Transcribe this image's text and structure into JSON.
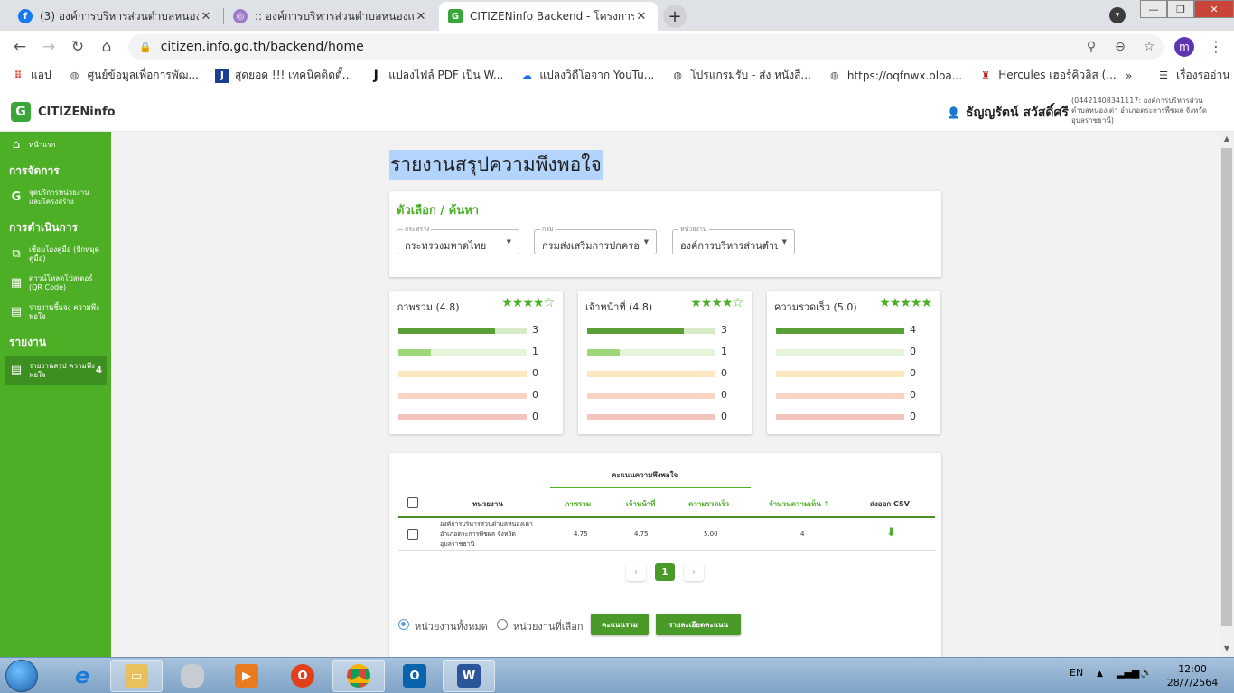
{
  "browser": {
    "tabs": [
      {
        "title": "(3) องค์การบริหารส่วนตำบลหนองเต่า |",
        "icon": "facebook-icon",
        "color": "#1877f2"
      },
      {
        "title": ":: องค์การบริหารส่วนตำบลหนองเต่า อำ",
        "icon": "site-emblem-icon",
        "color": "#9c7cc9"
      },
      {
        "title": "CITIZENinfo Backend - โครงการกา",
        "icon": "citizeninfo-icon",
        "color": "#3aa63a"
      }
    ],
    "tab_close": "✕",
    "new_tab": "+",
    "url": "citizen.info.go.th/backend/home",
    "profile_initial": "m",
    "bookmarks": [
      {
        "label": "แอป",
        "icon": "apps-grid-icon"
      },
      {
        "label": "ศูนย์ข้อมูลเพื่อการพัฒ...",
        "icon": "globe-icon"
      },
      {
        "label": "สุดยอด !!! เทคนิคติดตั้...",
        "icon": "j-logo-icon"
      },
      {
        "label": "แปลงไฟล์ PDF เป็น W...",
        "icon": "j-logo-icon"
      },
      {
        "label": "แปลงวิดีโอจาก YouTu...",
        "icon": "cloud-download-icon"
      },
      {
        "label": "โปรแกรมรับ - ส่ง หนังสื...",
        "icon": "globe-icon"
      },
      {
        "label": "https://oqfnwx.oloa...",
        "icon": "globe-icon"
      },
      {
        "label": "Hercules เฮอร์คิวลิส (...",
        "icon": "hercules-icon"
      }
    ],
    "bookmarks_more": "»",
    "reading_list": "เรื่องรออ่าน"
  },
  "app": {
    "brand": "CITIZENinfo",
    "user_name": "ธัญญรัตน์ สวัสดิ์ศรี",
    "user_org": "(04421408341117: องค์การบริหารส่วนตำบลหนองเต่า อำเภอตระการพืชผล จังหวัดอุบลราชธานี)"
  },
  "sidebar": {
    "home": "หน้าแรก",
    "section_manage": "การจัดการ",
    "manage_items": [
      "จุดบริการหน่วยงาน และโครงสร้าง"
    ],
    "section_ops": "การดำเนินการ",
    "ops_items": [
      "เชื่อมโยงคู่มือ (ปักหมุดคู่มือ)",
      "ดาวน์โหลดโปสเตอร์ (QR Code)",
      "รายงานชี้แจง ความพึงพอใจ"
    ],
    "section_report": "รายงาน",
    "report_items": [
      {
        "label": "รายงานสรุป ความพึงพอใจ",
        "count": "4"
      }
    ]
  },
  "page": {
    "title": "รายงานสรุปความพึงพอใจ",
    "filters": {
      "title": "ตัวเลือก / ค้นหา",
      "fields": [
        {
          "label": "กระทรวง",
          "value": "กระทรวงมหาดไทย"
        },
        {
          "label": "กรม",
          "value": "กรมส่งเสริมการปกครอ"
        },
        {
          "label": "หน่วยงาน",
          "value": "องค์การบริหารส่วนตำบ"
        }
      ]
    },
    "rating_cards": [
      {
        "title": "ภาพรวม (4.8)",
        "stars": "★★★★☆",
        "bars": [
          {
            "fraction": 0.75,
            "count": "3"
          },
          {
            "fraction": 0.25,
            "count": "1"
          },
          {
            "fraction": 0,
            "count": "0"
          },
          {
            "fraction": 0,
            "count": "0"
          },
          {
            "fraction": 0,
            "count": "0"
          }
        ]
      },
      {
        "title": "เจ้าหน้าที่ (4.8)",
        "stars": "★★★★☆",
        "bars": [
          {
            "fraction": 0.75,
            "count": "3"
          },
          {
            "fraction": 0.25,
            "count": "1"
          },
          {
            "fraction": 0,
            "count": "0"
          },
          {
            "fraction": 0,
            "count": "0"
          },
          {
            "fraction": 0,
            "count": "0"
          }
        ]
      },
      {
        "title": "ความรวดเร็ว (5.0)",
        "stars": "★★★★★",
        "bars": [
          {
            "fraction": 1.0,
            "count": "4"
          },
          {
            "fraction": 0,
            "count": "0"
          },
          {
            "fraction": 0,
            "count": "0"
          },
          {
            "fraction": 0,
            "count": "0"
          },
          {
            "fraction": 0,
            "count": "0"
          }
        ]
      }
    ],
    "bar_colors": [
      {
        "fill": "#5a9e3a",
        "track": "#d7ebc8"
      },
      {
        "fill": "#9fd67a",
        "track": "#e6f4dc"
      },
      {
        "fill": "#f6d79a",
        "track": "#fbe7c0"
      },
      {
        "fill": "#f3b79b",
        "track": "#fad3c2"
      },
      {
        "fill": "#e9a59c",
        "track": "#f3c4bd"
      }
    ],
    "table": {
      "group_header": "คะแนนความพึงพอใจ",
      "columns": {
        "unit": "หน่วยงาน",
        "overall": "ภาพรวม",
        "staff": "เจ้าหน้าที่",
        "speed": "ความรวดเร็ว",
        "visits": "จำนวนความเห็น ↑",
        "csv": "ส่งออก CSV"
      },
      "rows": [
        {
          "unit": "องค์การบริหารส่วนตำบลหนองเต่า อำเภอตระการพืชผล จังหวัดอุบลราชธานี",
          "overall": "4.75",
          "staff": "4.75",
          "speed": "5.00",
          "visits": "4"
        }
      ],
      "pagination": {
        "prev": "‹",
        "current": "1",
        "next": "›"
      }
    },
    "scope": {
      "all_units": "หน่วยงานทั้งหมด",
      "selected_units": "หน่วยงานที่เลือก"
    },
    "buttons": {
      "summary": "คะแนนรวม",
      "detail": "รายละเอียดคะแนน"
    }
  },
  "taskbar": {
    "lang": "EN",
    "time": "12:00",
    "date": "28/7/2564"
  }
}
